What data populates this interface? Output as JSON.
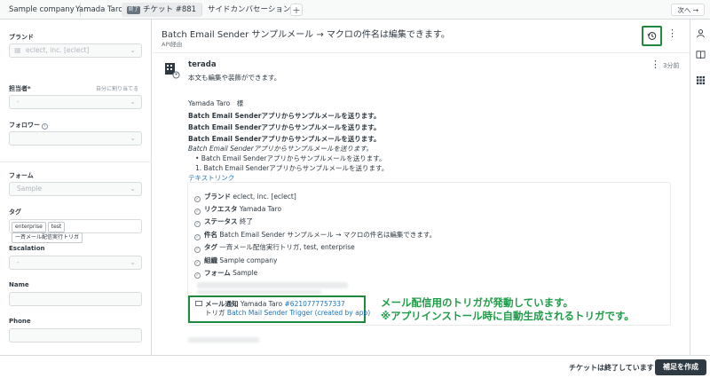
{
  "tabs": [
    {
      "label": "Sample company"
    },
    {
      "label": "Yamada Taro"
    },
    {
      "badge": "終了",
      "label": "チケット #881"
    },
    {
      "label": "サイドカンバセーション"
    }
  ],
  "tab_plus": "+",
  "next_button": "次へ →",
  "sidebar": {
    "brand_label": "ブランド",
    "brand_value": "eclect, inc. [eclect]",
    "assignee_label": "担当者*",
    "assignee_hint": "自分に割り当てる",
    "follower_label": "フォロワー",
    "form_label": "フォーム",
    "form_value": "Sample",
    "tags_label": "タグ",
    "tags": [
      "enterprise",
      "test",
      "一斉メール配信実行トリガ"
    ],
    "escalation_label": "Escalation",
    "escalation_value": "-",
    "assignee_value": "-",
    "name_label": "Name",
    "phone_label": "Phone"
  },
  "ticket": {
    "title": "Batch Email Sender サンプルメール → マクロの件名は編集できます。",
    "via": "API経由"
  },
  "message": {
    "author": "terada",
    "time": "3分前",
    "intro": "本文も編集や装飾ができます。",
    "greeting": "Yamada Taro　様",
    "bold_lines": [
      "Batch Email Senderアプリからサンプルメールを送ります。",
      "Batch Email Senderアプリからサンプルメールを送ります。",
      "Batch Email Senderアプリからサンプルメールを送ります。"
    ],
    "italic_line": "Batch Email Senderアプリからサンプルメールを送ります。",
    "bullet_item": "• Batch Email Senderアプリからサンプルメールを送ります。",
    "numbered_item": "1. Batch Email Senderアプリからサンプルメールを送ります。",
    "link_text": "テキストリンク"
  },
  "summary": [
    {
      "key": "ブランド",
      "value": "eclect, inc. [eclect]"
    },
    {
      "key": "リクエスタ",
      "value": "Yamada Taro"
    },
    {
      "key": "ステータス",
      "value": "終了"
    },
    {
      "key": "件名",
      "value": "Batch Email Sender サンプルメール → マクロの件名は編集できます。"
    },
    {
      "key": "タグ",
      "value": "一斉メール配信実行トリガ, test, enterprise"
    },
    {
      "key": "組織",
      "value": "Sample company"
    },
    {
      "key": "フォーム",
      "value": "Sample"
    }
  ],
  "notification": {
    "key": "メール通知",
    "recipient": "Yamada Taro",
    "id_link": "#6210777757337",
    "trigger_prefix": "トリガ",
    "trigger_link": "Batch Mail Sender Trigger (created by app)"
  },
  "annotation": {
    "line1": "メール配信用のトリガが発動しています。",
    "line2": "※アプリインストール時に自動生成されるトリガです。"
  },
  "footer": {
    "status": "チケットは終了しています",
    "button": "補足を作成"
  },
  "colors": {
    "highlight": "#1f8a3e",
    "annotation": "#1f9c48",
    "link": "#1f73b7",
    "primary_button": "#2f3941"
  }
}
